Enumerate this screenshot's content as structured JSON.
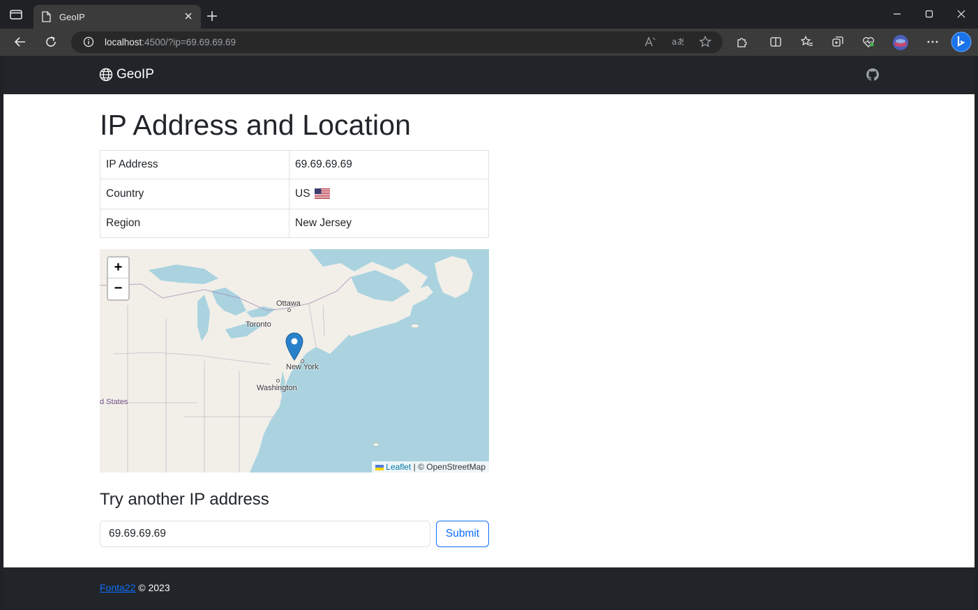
{
  "browser": {
    "tab_title": "GeoIP",
    "url_host": "localhost",
    "url_rest": ":4500/?ip=69.69.69.69"
  },
  "navbar": {
    "brand": "GeoIP",
    "brand_icon": "globe-icon",
    "github_icon": "github-icon"
  },
  "page": {
    "title": "IP Address and Location"
  },
  "info": {
    "rows": [
      {
        "label": "IP Address",
        "value": "69.69.69.69"
      },
      {
        "label": "Country",
        "value": "US"
      },
      {
        "label": "Region",
        "value": "New Jersey"
      }
    ]
  },
  "map": {
    "zoom_in": "+",
    "zoom_out": "−",
    "cities": [
      "Ottawa",
      "Toronto",
      "New York",
      "Washington"
    ],
    "region_label": "d States",
    "attribution_leaflet": "Leaflet",
    "attribution_rest": " | © OpenStreetMap"
  },
  "form": {
    "heading": "Try another IP address",
    "input_value": "69.69.69.69",
    "submit_label": "Submit"
  },
  "footer": {
    "author": "Fonta22",
    "year_text": " © 2023"
  },
  "colors": {
    "navbar_bg": "#212529",
    "primary": "#0d6efd",
    "map_water": "#aad3df",
    "map_land": "#f2efe9"
  }
}
